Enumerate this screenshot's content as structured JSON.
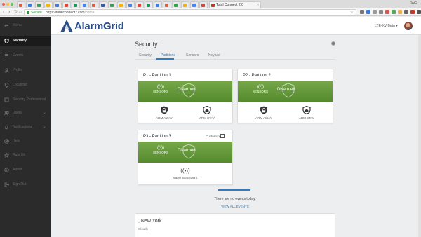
{
  "browser": {
    "active_tab_title": "Total Connect 2.0",
    "user_label": "JAG",
    "secure_label": "Secure",
    "url_host": "https://totalconnect2.com",
    "url_path": "/home"
  },
  "header": {
    "logo_text": "AlarmGrid",
    "account_label": "LTE-XV Beta ▾"
  },
  "sidebar": {
    "items": [
      {
        "label": "Menu"
      },
      {
        "label": "Security"
      },
      {
        "label": "Events"
      },
      {
        "label": "Profile"
      },
      {
        "label": "Locations"
      },
      {
        "label": "Security Professional"
      },
      {
        "label": "Users"
      },
      {
        "label": "Notifications"
      },
      {
        "label": "Help"
      },
      {
        "label": "Rate Us"
      },
      {
        "label": "About"
      },
      {
        "label": "Sign Out"
      }
    ]
  },
  "main": {
    "title": "Security",
    "tabs": [
      {
        "label": "Security"
      },
      {
        "label": "Partitions"
      },
      {
        "label": "Sensors"
      },
      {
        "label": "Keypad"
      }
    ],
    "active_tab": "Partitions",
    "partitions": [
      {
        "title": "P1 - Partition 1",
        "status": "Disarmed",
        "sensors_label": "SENSORS",
        "arm_away": "ARM AWAY",
        "arm_stay": "ARM STAY"
      },
      {
        "title": "P2 - Partition 2",
        "status": "Disarmed",
        "sensors_label": "SENSORS",
        "arm_away": "ARM AWAY",
        "arm_stay": "ARM STAY"
      },
      {
        "title": "P3 - Partition 3",
        "status": "Disarmed",
        "sensors_label": "SENSORS",
        "customize": "Customize",
        "view_sensors": "VIEW SENSORS"
      }
    ],
    "events": {
      "empty_text": "There are no events today.",
      "view_all": "VIEW ALL EVENTS"
    },
    "weather": {
      "city": ", New York",
      "condition": "Cloudy"
    }
  },
  "colors": {
    "accent": "#2f7ac0",
    "status_green": "#5e9436",
    "sidebar_bg": "#2b2b2b",
    "logo_blue": "#2d4f88"
  }
}
